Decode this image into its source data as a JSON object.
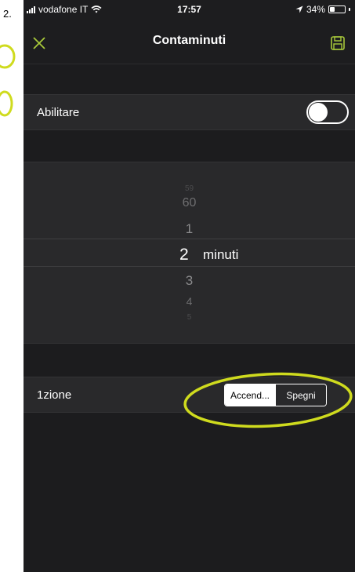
{
  "step_label": "2.",
  "status_bar": {
    "carrier": "vodafone IT",
    "time": "17:57",
    "battery": "34%",
    "battery_level": 0.34
  },
  "nav": {
    "title": "Contaminuti",
    "close_icon": "close-icon",
    "save_icon": "save-icon",
    "accent_color": "#a8c93a"
  },
  "enable_row": {
    "label": "Abilitare",
    "toggle_on": false
  },
  "picker": {
    "values": [
      "59",
      "60",
      "1",
      "2",
      "3",
      "4",
      "5"
    ],
    "selected": "2",
    "unit": "minuti"
  },
  "action_row": {
    "label": "1zione",
    "options": [
      "Accend...",
      "Spegni"
    ],
    "selected_index": 0
  },
  "annotation_color": "#cfdb1e"
}
